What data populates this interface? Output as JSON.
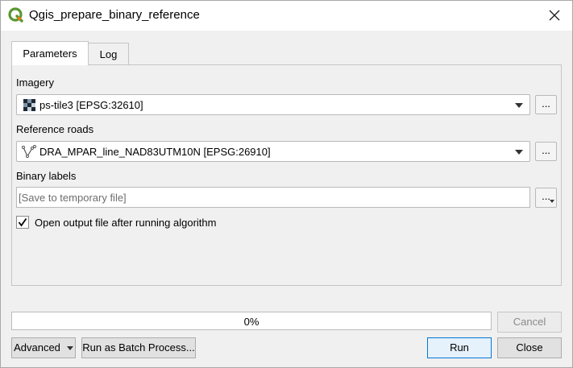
{
  "window": {
    "title": "Qgis_prepare_binary_reference"
  },
  "tabs": [
    {
      "label": "Parameters"
    },
    {
      "label": "Log"
    }
  ],
  "params": {
    "imagery": {
      "label": "Imagery",
      "value": "ps-tile3 [EPSG:32610]",
      "icon": "raster-layer-icon"
    },
    "reference_roads": {
      "label": "Reference roads",
      "value": "DRA_MPAR_line_NAD83UTM10N [EPSG:26910]",
      "icon": "line-layer-icon"
    },
    "binary_labels": {
      "label": "Binary labels",
      "placeholder": "[Save to temporary file]"
    },
    "open_output": {
      "label": "Open output file after running algorithm",
      "checked": true
    },
    "browse_label": "..."
  },
  "progress": {
    "text": "0%",
    "value": 0,
    "color": "#06b025"
  },
  "buttons": {
    "cancel": "Cancel",
    "advanced": "Advanced",
    "batch": "Run as Batch Process...",
    "run": "Run",
    "close": "Close"
  },
  "colors": {
    "qgis_green": "#589632",
    "qgis_yellow": "#ee7913",
    "default_button_border": "#0078d7"
  }
}
